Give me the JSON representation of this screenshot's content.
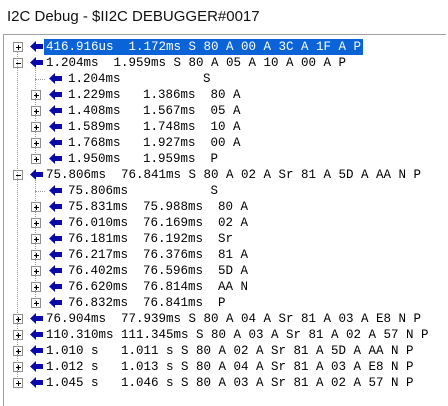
{
  "window": {
    "title": "I2C Debug - $II2C DEBUGGER#0017"
  },
  "colors": {
    "arrow": "#0a0aa8",
    "selection": "#0a64d8"
  },
  "icons": {
    "row_icon": "left-arrow-icon"
  },
  "tree": [
    {
      "level": 0,
      "expander": "plus",
      "selected": true,
      "text": "416.916us  1.172ms S 80 A 00 A 3C A 1F A P"
    },
    {
      "level": 0,
      "expander": "minus",
      "selected": false,
      "text": "1.204ms  1.959ms S 80 A 05 A 10 A 00 A P"
    },
    {
      "level": 1,
      "expander": "none",
      "selected": false,
      "text": "1.204ms           S"
    },
    {
      "level": 1,
      "expander": "plus",
      "selected": false,
      "text": "1.229ms   1.386ms  80 A"
    },
    {
      "level": 1,
      "expander": "plus",
      "selected": false,
      "text": "1.408ms   1.567ms  05 A"
    },
    {
      "level": 1,
      "expander": "plus",
      "selected": false,
      "text": "1.589ms   1.748ms  10 A"
    },
    {
      "level": 1,
      "expander": "plus",
      "selected": false,
      "text": "1.768ms   1.927ms  00 A"
    },
    {
      "level": 1,
      "expander": "plus",
      "selected": false,
      "text": "1.950ms   1.959ms  P"
    },
    {
      "level": 0,
      "expander": "minus",
      "selected": false,
      "text": "75.806ms  76.841ms S 80 A 02 A Sr 81 A 5D A AA N P"
    },
    {
      "level": 1,
      "expander": "none",
      "selected": false,
      "text": "75.806ms           S"
    },
    {
      "level": 1,
      "expander": "plus",
      "selected": false,
      "text": "75.831ms  75.988ms  80 A"
    },
    {
      "level": 1,
      "expander": "plus",
      "selected": false,
      "text": "76.010ms  76.169ms  02 A"
    },
    {
      "level": 1,
      "expander": "plus",
      "selected": false,
      "text": "76.181ms  76.192ms  Sr"
    },
    {
      "level": 1,
      "expander": "plus",
      "selected": false,
      "text": "76.217ms  76.376ms  81 A"
    },
    {
      "level": 1,
      "expander": "plus",
      "selected": false,
      "text": "76.402ms  76.596ms  5D A"
    },
    {
      "level": 1,
      "expander": "plus",
      "selected": false,
      "text": "76.620ms  76.814ms  AA N"
    },
    {
      "level": 1,
      "expander": "plus",
      "selected": false,
      "text": "76.832ms  76.841ms  P"
    },
    {
      "level": 0,
      "expander": "plus",
      "selected": false,
      "text": "76.904ms  77.939ms S 80 A 04 A Sr 81 A 03 A E8 N P"
    },
    {
      "level": 0,
      "expander": "plus",
      "selected": false,
      "text": "110.310ms 111.345ms S 80 A 03 A Sr 81 A 02 A 57 N P"
    },
    {
      "level": 0,
      "expander": "plus",
      "selected": false,
      "text": "1.010 s   1.011 s S 80 A 02 A Sr 81 A 5D A AA N P"
    },
    {
      "level": 0,
      "expander": "plus",
      "selected": false,
      "text": "1.012 s   1.013 s S 80 A 04 A Sr 81 A 03 A E8 N P"
    },
    {
      "level": 0,
      "expander": "plus",
      "selected": false,
      "text": "1.045 s   1.046 s S 80 A 03 A Sr 81 A 02 A 57 N P"
    }
  ]
}
